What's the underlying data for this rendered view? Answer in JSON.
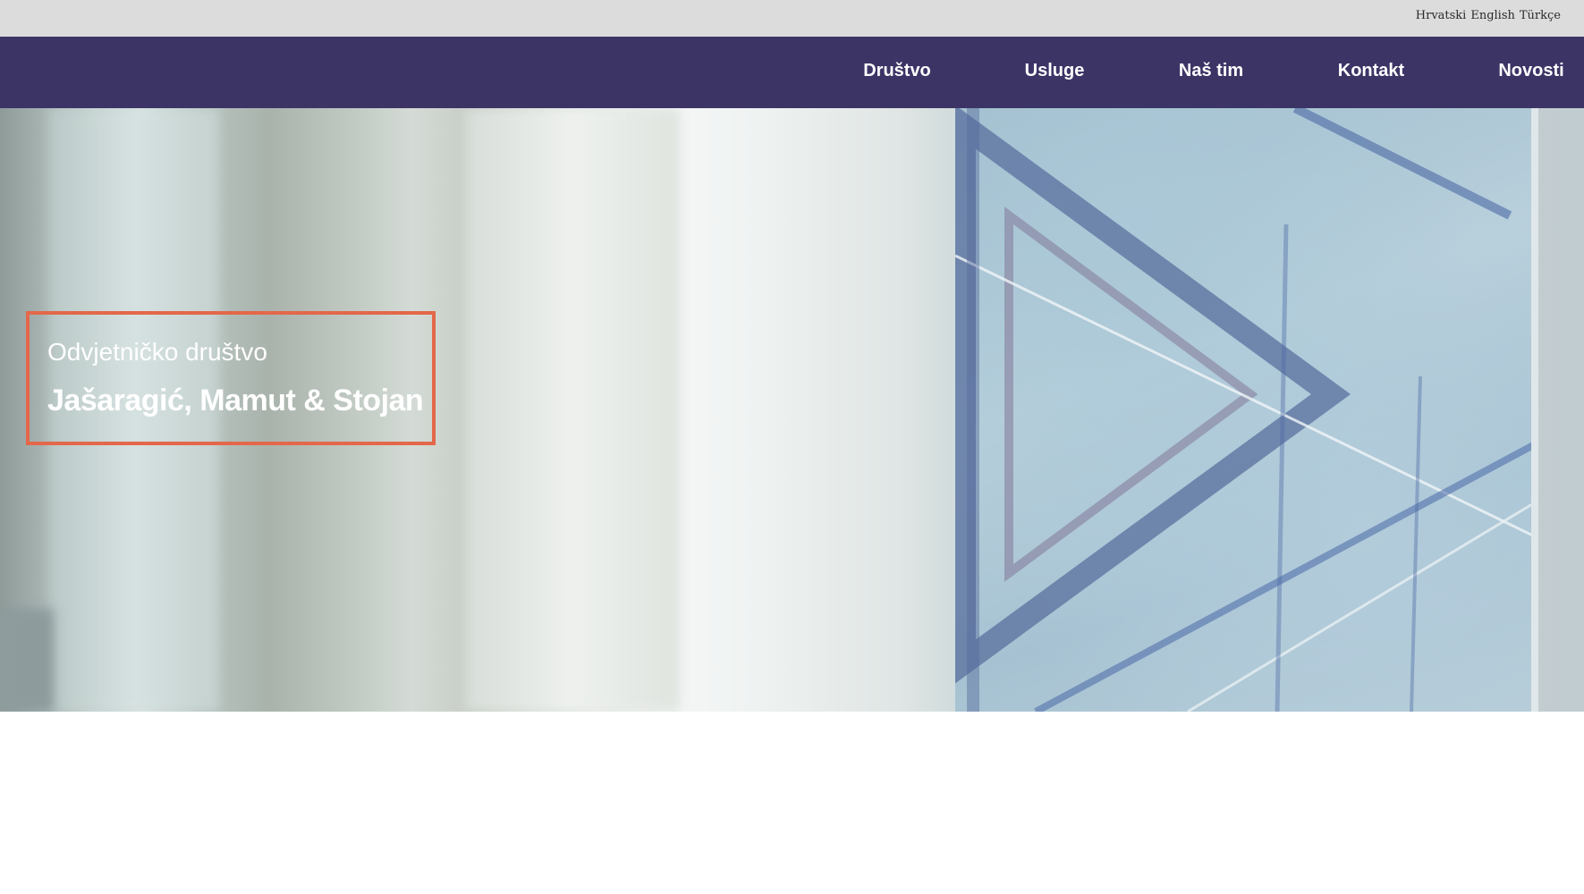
{
  "languages": [
    "Hrvatski",
    "English",
    "Türkçe"
  ],
  "nav": {
    "items": [
      "Društvo",
      "Usluge",
      "Naš tim",
      "Kontakt",
      "Novosti"
    ]
  },
  "hero": {
    "subtitle": "Odvjetničko društvo",
    "title": "Jašaragić, Mamut & Stojan"
  },
  "colors": {
    "lang_bar": "#dcdcdc",
    "nav_bar": "#3d3466",
    "hero_box_border": "#e4674a"
  }
}
